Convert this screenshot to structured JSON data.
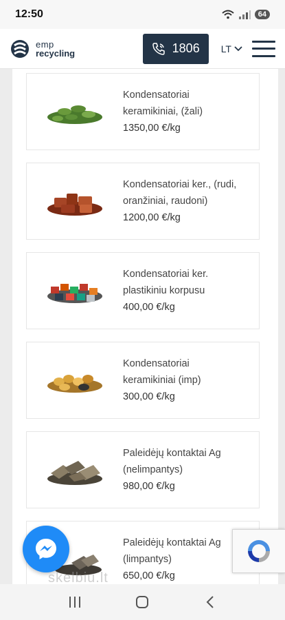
{
  "status": {
    "time": "12:50",
    "battery": "64"
  },
  "header": {
    "logo_line1": "emp",
    "logo_line2": "recycling",
    "phone_label": "1806",
    "language": "LT"
  },
  "products": [
    {
      "name": "Kondensatoriai keramikiniai, (žali)",
      "price": "1350,00 €/kg",
      "color": "#5a8a3a"
    },
    {
      "name": "Kondensatoriai ker., (rudi, oranžiniai, raudoni)",
      "price": "1200,00 €/kg",
      "color": "#9c3b20"
    },
    {
      "name": "Kondensatoriai ker. plastikiniu korpusu",
      "price": "400,00 €/kg",
      "color": "#c0392b"
    },
    {
      "name": "Kondensatoriai keramikiniai (imp)",
      "price": "300,00 €/kg",
      "color": "#d9a23a"
    },
    {
      "name": "Paleidėjų kontaktai Ag (nelimpantys)",
      "price": "980,00 €/kg",
      "color": "#7b6e58"
    },
    {
      "name": "Paleidėjų kontaktai Ag (limpantys)",
      "price": "650,00 €/kg",
      "color": "#6b6358"
    }
  ],
  "watermark": "skelbiu.lt",
  "colors": {
    "brand": "#233447",
    "messenger": "#1f8bf7"
  }
}
